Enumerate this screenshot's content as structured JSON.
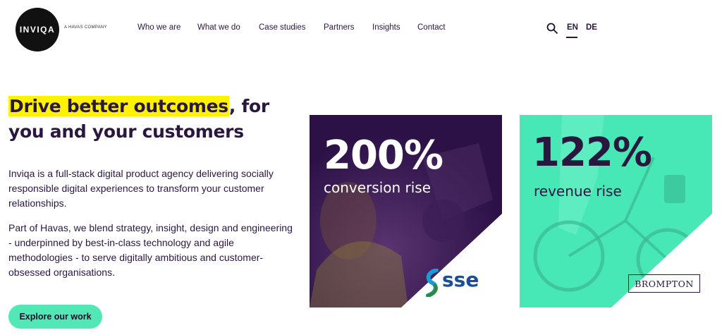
{
  "header": {
    "logo_text": "INVIQA",
    "tagline": "A HAVAS COMPANY",
    "nav": [
      {
        "label": "Who we are"
      },
      {
        "label": "What we do"
      },
      {
        "label": "Case studies"
      },
      {
        "label": "Partners"
      },
      {
        "label": "Insights"
      },
      {
        "label": "Contact"
      }
    ],
    "languages": [
      "EN",
      "DE"
    ],
    "active_language": "EN"
  },
  "hero": {
    "headline_highlight": "Drive better outcomes",
    "headline_rest_1": ", for",
    "headline_rest_2": "you and your customers",
    "paragraph_1": "Inviqa is a full-stack digital product agency delivering socially responsible digital experiences to transform your customer relationships.",
    "paragraph_2": "Part of Havas, we blend strategy, insight, design and engineering - underpinned by best-in-class technology and agile methodologies - to serve digitally ambitious and customer-obsessed organisations.",
    "cta_label": "Explore our work"
  },
  "cards": [
    {
      "stat": "200%",
      "label": "conversion rise",
      "brand": "sse"
    },
    {
      "stat": "122%",
      "label": "revenue rise",
      "brand": "BROMPTON"
    }
  ],
  "colors": {
    "highlight": "#fff200",
    "accent": "#52e8b5",
    "dark": "#2a1740",
    "card_purple": "#2c1147",
    "card_teal": "#48e8b6"
  }
}
